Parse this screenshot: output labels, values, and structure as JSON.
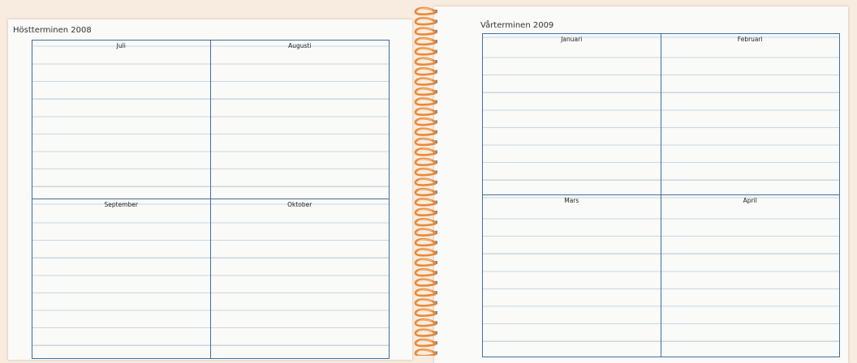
{
  "left_page": {
    "title": "Höstterminen 2008",
    "months": [
      "Juli",
      "Augusti",
      "September",
      "Oktober"
    ]
  },
  "right_page": {
    "title": "Vårterminen 2009",
    "months": [
      "Januari",
      "Februari",
      "Mars",
      "April"
    ]
  },
  "colors": {
    "background": "#f7ecdf",
    "paper": "#fafaf8",
    "grid_line": "#3d6fa3",
    "ruling": "#c9d6e2",
    "spiral": "#e8893a"
  }
}
